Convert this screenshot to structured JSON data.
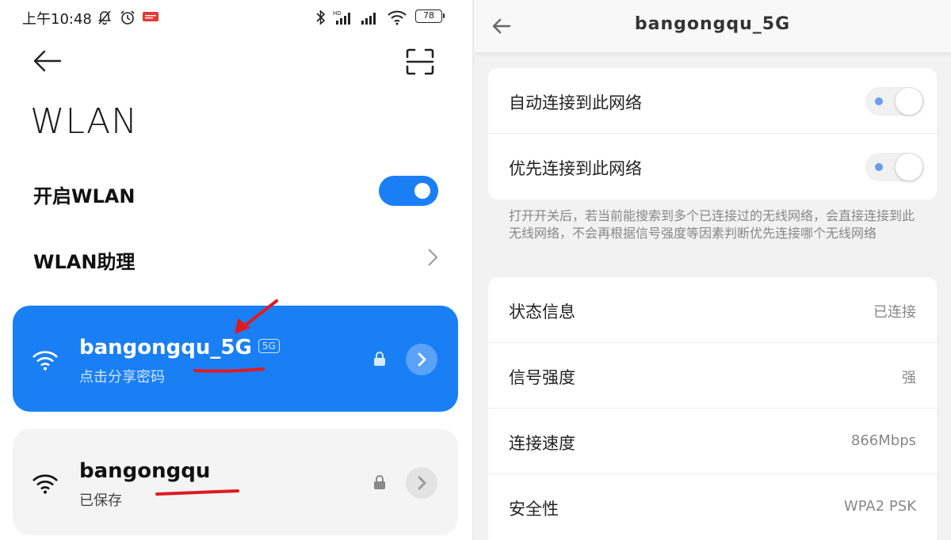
{
  "status_bar": {
    "time": "上午10:48",
    "battery": "78"
  },
  "wlan_screen": {
    "title": "WLAN",
    "enable_label": "开启WLAN",
    "enable_on": true,
    "assistant_label": "WLAN助理",
    "networks": [
      {
        "ssid": "bangongqu_5G",
        "badge": "5G",
        "subtitle": "点击分享密码",
        "connected": true
      },
      {
        "ssid": "bangongqu",
        "subtitle": "已保存",
        "connected": false
      }
    ]
  },
  "detail_screen": {
    "title": "bangongqu_5G",
    "toggles": [
      {
        "label": "自动连接到此网络",
        "on": false
      },
      {
        "label": "优先连接到此网络",
        "on": false
      }
    ],
    "note": "打开开关后，若当前能搜索到多个已连接过的无线网络，会直接连接到此无线网络，不会再根据信号强度等因素判断优先连接哪个无线网络",
    "info": [
      {
        "label": "状态信息",
        "value": "已连接"
      },
      {
        "label": "信号强度",
        "value": "强"
      },
      {
        "label": "连接速度",
        "value": "866Mbps"
      },
      {
        "label": "安全性",
        "value": "WPA2 PSK"
      }
    ]
  },
  "colors": {
    "accent": "#1a7ff5",
    "annotation": "#e01a22"
  },
  "icons": [
    "mute-icon",
    "alarm-icon",
    "app-badge-icon",
    "bluetooth-icon",
    "signal-icon",
    "wifi-icon",
    "battery-icon",
    "back-arrow-icon",
    "scan-icon",
    "chevron-right-icon",
    "lock-icon"
  ]
}
